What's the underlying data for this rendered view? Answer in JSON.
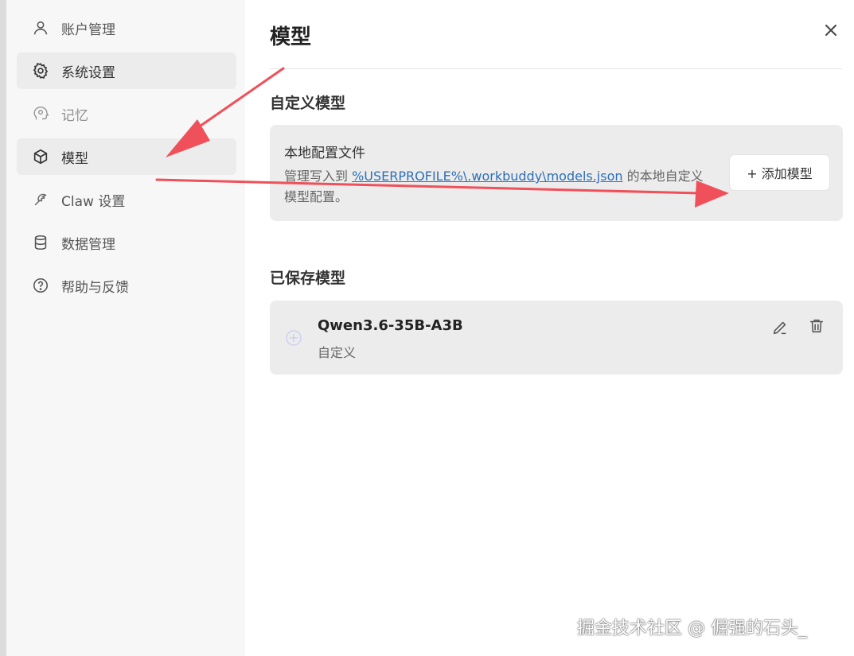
{
  "sidebar": {
    "items": [
      {
        "label": "账户管理",
        "icon": "user-icon"
      },
      {
        "label": "系统设置",
        "icon": "gear-icon"
      },
      {
        "label": "记忆",
        "icon": "memory-head-icon"
      },
      {
        "label": "模型",
        "icon": "cube-icon"
      },
      {
        "label": "Claw 设置",
        "icon": "claw-icon"
      },
      {
        "label": "数据管理",
        "icon": "database-icon"
      },
      {
        "label": "帮助与反馈",
        "icon": "help-icon"
      }
    ]
  },
  "main": {
    "title": "模型",
    "custom_section": {
      "title": "自定义模型",
      "card_title": "本地配置文件",
      "desc_prefix": "管理写入到 ",
      "desc_link": "%USERPROFILE%\\.workbuddy\\models.json",
      "desc_suffix": " 的本地自定义模型配置。",
      "add_button": "+ 添加模型"
    },
    "saved_section": {
      "title": "已保存模型",
      "models": [
        {
          "name": "Qwen3.6-35B-A3B",
          "type": "自定义"
        }
      ]
    }
  },
  "watermark": "掘金技术社区 @ 倔强的石头_",
  "colors": {
    "sidebar_bg": "#f7f7f7",
    "active_item_bg": "#ececec",
    "card_bg": "#ececec",
    "link": "#2d6fb8",
    "annotation_arrow": "#f0505a"
  }
}
